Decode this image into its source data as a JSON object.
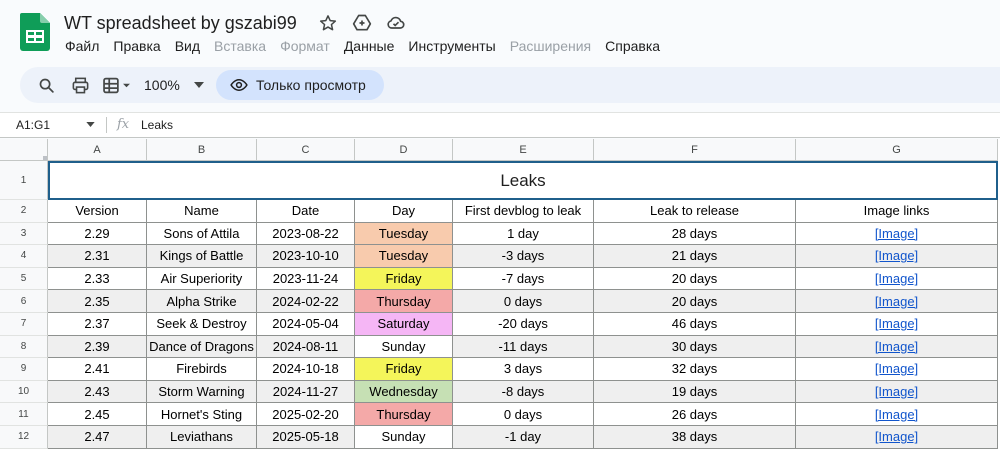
{
  "header": {
    "title": "WT spreadsheet by gszabi99",
    "menu": [
      {
        "label": "Файл",
        "disabled": false
      },
      {
        "label": "Правка",
        "disabled": false
      },
      {
        "label": "Вид",
        "disabled": false
      },
      {
        "label": "Вставка",
        "disabled": true
      },
      {
        "label": "Формат",
        "disabled": true
      },
      {
        "label": "Данные",
        "disabled": false
      },
      {
        "label": "Инструменты",
        "disabled": false
      },
      {
        "label": "Расширения",
        "disabled": true
      },
      {
        "label": "Справка",
        "disabled": false
      }
    ]
  },
  "toolbar": {
    "zoom": "100%",
    "view_only": "Только просмотр"
  },
  "formula_bar": {
    "cell_ref": "A1:G1",
    "fx": "fx",
    "value": "Leaks"
  },
  "sheet": {
    "columns": [
      "A",
      "B",
      "C",
      "D",
      "E",
      "F",
      "G"
    ],
    "row_numbers": [
      "1",
      "2",
      "3",
      "4",
      "5",
      "6",
      "7",
      "8",
      "9",
      "10",
      "11",
      "12"
    ],
    "title": "Leaks",
    "headers": [
      "Version",
      "Name",
      "Date",
      "Day",
      "First devblog to leak",
      "Leak to release",
      "Image links"
    ],
    "rows": [
      {
        "version": "2.29",
        "name": "Sons of Attila",
        "date": "2023-08-22",
        "day": "Tuesday",
        "devblog": "1 day",
        "release": "28 days",
        "link": "[Image]"
      },
      {
        "version": "2.31",
        "name": "Kings of Battle",
        "date": "2023-10-10",
        "day": "Tuesday",
        "devblog": "-3 days",
        "release": "21 days",
        "link": "[Image]"
      },
      {
        "version": "2.33",
        "name": "Air Superiority",
        "date": "2023-11-24",
        "day": "Friday",
        "devblog": "-7 days",
        "release": "20 days",
        "link": "[Image]"
      },
      {
        "version": "2.35",
        "name": "Alpha Strike",
        "date": "2024-02-22",
        "day": "Thursday",
        "devblog": "0 days",
        "release": "20 days",
        "link": "[Image]"
      },
      {
        "version": "2.37",
        "name": "Seek & Destroy",
        "date": "2024-05-04",
        "day": "Saturday",
        "devblog": "-20 days",
        "release": "46 days",
        "link": "[Image]"
      },
      {
        "version": "2.39",
        "name": "Dance of Dragons",
        "date": "2024-08-11",
        "day": "Sunday",
        "devblog": "-11 days",
        "release": "30 days",
        "link": "[Image]"
      },
      {
        "version": "2.41",
        "name": "Firebirds",
        "date": "2024-10-18",
        "day": "Friday",
        "devblog": "3 days",
        "release": "32 days",
        "link": "[Image]"
      },
      {
        "version": "2.43",
        "name": "Storm Warning",
        "date": "2024-11-27",
        "day": "Wednesday",
        "devblog": "-8 days",
        "release": "19 days",
        "link": "[Image]"
      },
      {
        "version": "2.45",
        "name": "Hornet's Sting",
        "date": "2025-02-20",
        "day": "Thursday",
        "devblog": "0 days",
        "release": "26 days",
        "link": "[Image]"
      },
      {
        "version": "2.47",
        "name": "Leviathans",
        "date": "2025-05-18",
        "day": "Sunday",
        "devblog": "-1 day",
        "release": "38 days",
        "link": "[Image]"
      }
    ],
    "day_colors": {
      "Tuesday": "#f8cbad",
      "Friday": "#f4f55a",
      "Thursday": "#f4a9a8",
      "Saturday": "#f5b6f5",
      "Sunday": "#ffffff",
      "Wednesday": "#c6e0b4"
    },
    "stripe_color": "#efefef",
    "link_color": "#1155cc"
  },
  "colors": {
    "accent": "#0b57d0",
    "sheets_green": "#0f9d58",
    "view_only_bg": "#d3e3fd"
  }
}
